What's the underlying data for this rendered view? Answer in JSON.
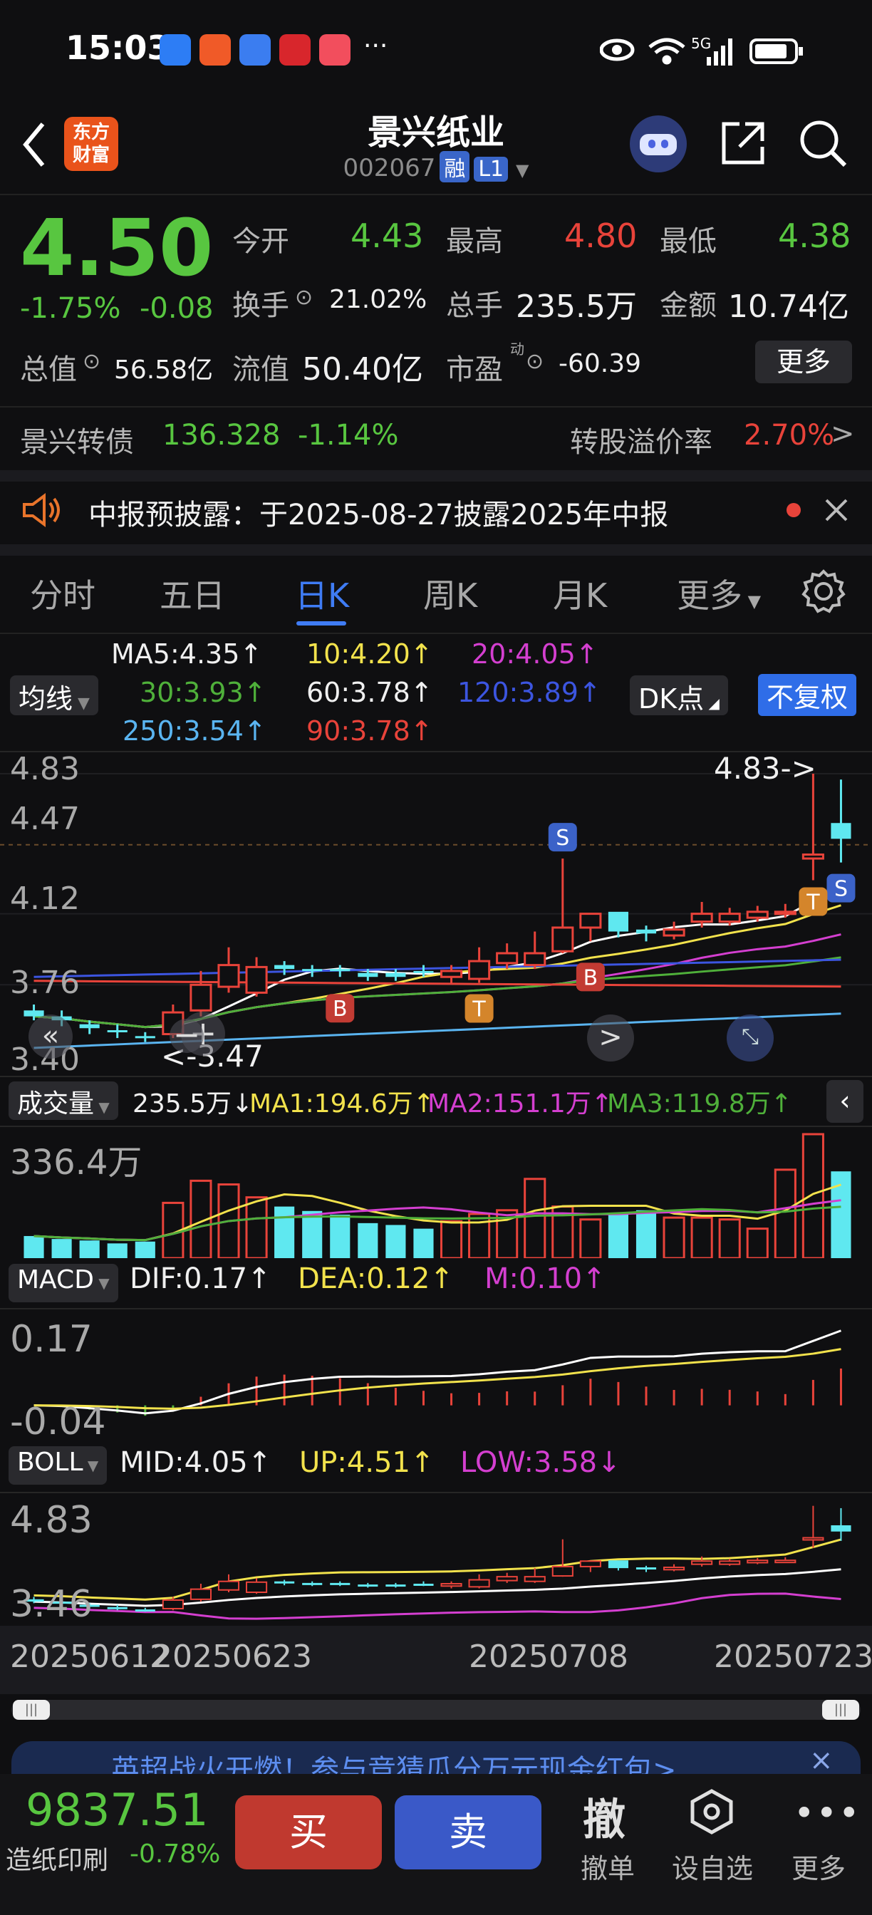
{
  "status_bar": {
    "time": "15:03",
    "more": "···",
    "signal": "5G"
  },
  "header": {
    "logo_text": "东方\n财富",
    "stock_name": "景兴纸业",
    "stock_code": "002067",
    "tag_margin": "融",
    "tag_level": "L1"
  },
  "quote": {
    "price": "4.50",
    "change_pct": "-1.75%",
    "change": "-0.08",
    "open_label": "今开",
    "open": "4.43",
    "high_label": "最高",
    "high": "4.80",
    "low_label": "最低",
    "low": "4.38",
    "turnover_label": "换手",
    "turnover": "21.02%",
    "volume_label": "总手",
    "volume": "235.5万",
    "amount_label": "金额",
    "amount": "10.74亿",
    "mktcap_label": "总值",
    "mktcap": "56.58亿",
    "float_label": "流值",
    "float": "50.40亿",
    "pe_label": "市盈",
    "pe_sup": "动",
    "pe": "-60.39",
    "more_label": "更多"
  },
  "bond": {
    "name": "景兴转债",
    "price": "136.328",
    "change": "-1.14%",
    "premium_label": "转股溢价率",
    "premium": "2.70%"
  },
  "notice": {
    "text": "中报预披露：于2025-08-27披露2025年中报"
  },
  "tabs": [
    "分时",
    "五日",
    "日K",
    "周K",
    "月K",
    "更多"
  ],
  "active_tab": "日K",
  "ma_panel": {
    "selector": "均线",
    "ma5": "MA5:4.35↑",
    "ma10": "10:4.20↑",
    "ma20": "20:4.05↑",
    "ma30": "30:3.93↑",
    "ma60": "60:3.78↑",
    "ma120": "120:3.89↑",
    "ma250": "250:3.54↑",
    "ma90": "90:3.78↑",
    "dk_label": "DK点",
    "fq_label": "不复权"
  },
  "main_chart": {
    "y_top": "4.83",
    "y_2": "4.47",
    "y_3": "4.12",
    "y_4": "3.76",
    "y_bottom": "3.40",
    "max_marker": "4.83->",
    "min_marker": "<-3.47"
  },
  "volume_panel": {
    "selector": "成交量",
    "vol": "235.5万↓",
    "ma1": "MA1:194.6万↑",
    "ma2": "MA2:151.1万↑",
    "ma3": "MA3:119.8万↑",
    "y_top": "336.4万"
  },
  "macd_panel": {
    "selector": "MACD",
    "dif": "DIF:0.17↑",
    "dea": "DEA:0.12↑",
    "m": "M:0.10↑",
    "y_top": "0.17",
    "y_bottom": "-0.04"
  },
  "boll_panel": {
    "selector": "BOLL",
    "mid": "MID:4.05↑",
    "up": "UP:4.51↑",
    "low": "LOW:3.58↓",
    "y_top": "4.83",
    "y_bottom": "3.46"
  },
  "dates": [
    "20250612",
    "20250623",
    "20250708",
    "20250723"
  ],
  "banner": {
    "text": "英超战火开燃！参与竞猜瓜分万元现金红包>"
  },
  "bottom_bar": {
    "index_value": "9837.51",
    "index_name": "造纸印刷",
    "index_change": "-0.78%",
    "buy": "买",
    "sell": "卖",
    "withdraw_icon": "撤",
    "withdraw": "撤单",
    "watch": "设自选",
    "more": "更多"
  },
  "chart_data": {
    "type": "candlestick",
    "x": [
      "20250612",
      "20250613",
      "20250616",
      "20250617",
      "20250618",
      "20250619",
      "20250620",
      "20250623",
      "20250624",
      "20250625",
      "20250626",
      "20250627",
      "20250630",
      "20250701",
      "20250702",
      "20250703",
      "20250704",
      "20250707",
      "20250708",
      "20250709",
      "20250710",
      "20250711",
      "20250714",
      "20250715",
      "20250716",
      "20250717",
      "20250718",
      "20250721",
      "20250722",
      "20250723"
    ],
    "open": [
      3.63,
      3.6,
      3.56,
      3.53,
      3.5,
      3.51,
      3.63,
      3.75,
      3.72,
      3.86,
      3.84,
      3.84,
      3.82,
      3.82,
      3.83,
      3.8,
      3.79,
      3.87,
      3.86,
      3.93,
      4.05,
      4.13,
      4.04,
      4.01,
      4.08,
      4.08,
      4.1,
      4.12,
      4.4,
      4.58
    ],
    "close": [
      3.6,
      3.58,
      3.54,
      3.52,
      3.49,
      3.62,
      3.76,
      3.86,
      3.85,
      3.84,
      3.83,
      3.83,
      3.8,
      3.8,
      3.82,
      3.83,
      3.88,
      3.92,
      3.92,
      4.05,
      4.12,
      4.03,
      4.02,
      4.04,
      4.12,
      4.12,
      4.13,
      4.13,
      4.42,
      4.5
    ],
    "high": [
      3.66,
      3.63,
      3.58,
      3.56,
      3.52,
      3.66,
      3.83,
      3.95,
      3.9,
      3.88,
      3.86,
      3.86,
      3.84,
      3.84,
      3.86,
      3.86,
      3.95,
      3.97,
      4.03,
      4.4,
      4.12,
      4.12,
      4.06,
      4.08,
      4.18,
      4.15,
      4.16,
      4.17,
      4.83,
      4.8
    ],
    "low": [
      3.58,
      3.55,
      3.51,
      3.49,
      3.47,
      3.49,
      3.6,
      3.72,
      3.7,
      3.81,
      3.8,
      3.8,
      3.78,
      3.78,
      3.8,
      3.77,
      3.77,
      3.84,
      3.84,
      3.92,
      3.98,
      4.0,
      3.98,
      3.99,
      4.05,
      4.06,
      4.08,
      4.1,
      4.29,
      4.38
    ],
    "ylim": [
      3.4,
      4.83
    ],
    "volume": [
      60,
      52,
      48,
      40,
      45,
      150,
      210,
      200,
      165,
      140,
      128,
      118,
      95,
      90,
      80,
      100,
      120,
      130,
      215,
      140,
      105,
      120,
      130,
      110,
      110,
      105,
      80,
      240,
      336.4,
      235.5
    ]
  }
}
